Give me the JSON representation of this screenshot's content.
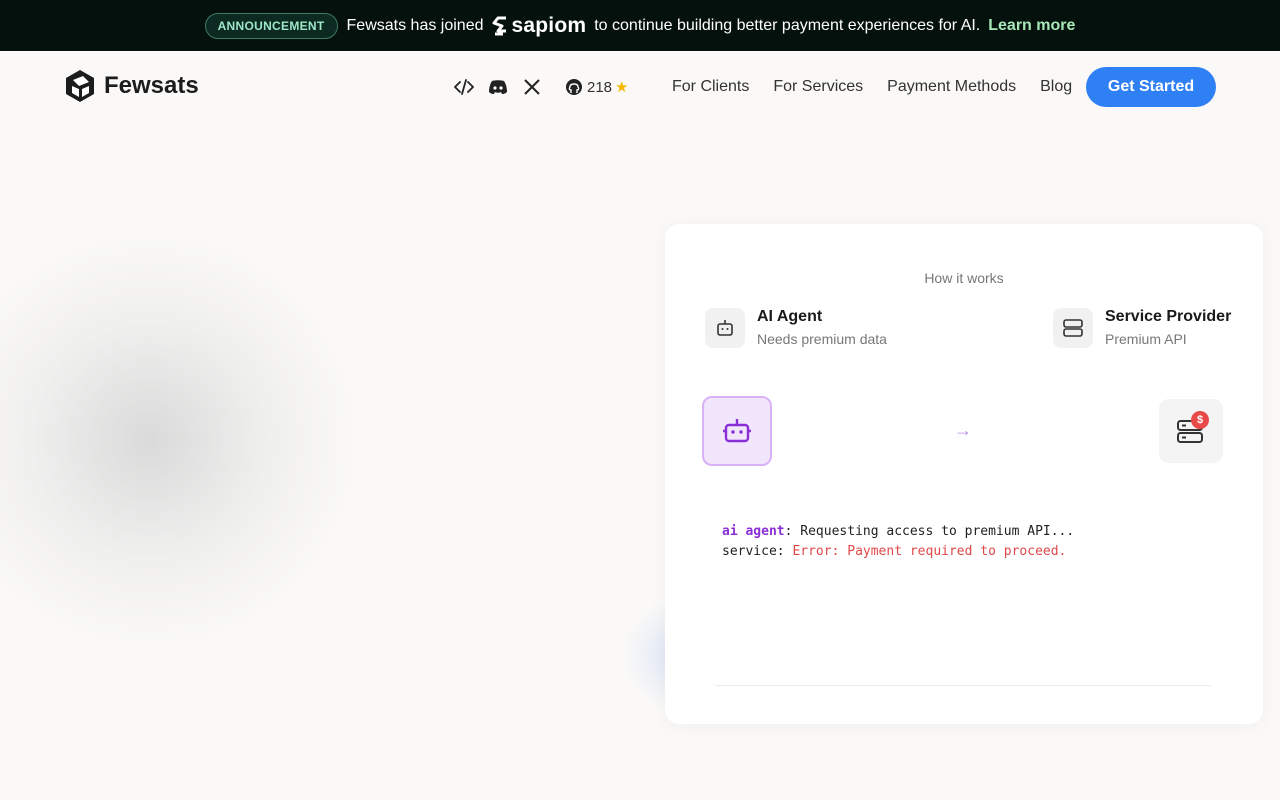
{
  "announcement": {
    "badge": "ANNOUNCEMENT",
    "text_before": "Fewsats has joined",
    "partner": "sapiom",
    "text_after": "to continue building better payment experiences for AI.",
    "link": "Learn more"
  },
  "header": {
    "brand": "Fewsats",
    "icons": [
      "code-icon",
      "discord-icon",
      "x-icon"
    ],
    "github_stars": "218",
    "nav": [
      "For Clients",
      "For Services",
      "Payment Methods",
      "Blog"
    ],
    "cta": "Get Started"
  },
  "card": {
    "heading": "How it works",
    "agent": {
      "name": "AI Agent",
      "desc": "Needs premium data"
    },
    "provider": {
      "name": "Service Provider",
      "desc": "Premium API"
    },
    "badge_symbol": "$",
    "arrow": "→",
    "log": [
      {
        "who": "ai agent",
        "sep": ":",
        "message": " Requesting access to premium API...",
        "error": false
      },
      {
        "who": "service",
        "sep": ":",
        "message": " Error: Payment required to proceed.",
        "error": true
      }
    ]
  },
  "colors": {
    "cta": "#2f80f5",
    "agent_accent": "#8a2fd6",
    "error": "#e04848",
    "announce_bg": "#05110d"
  }
}
